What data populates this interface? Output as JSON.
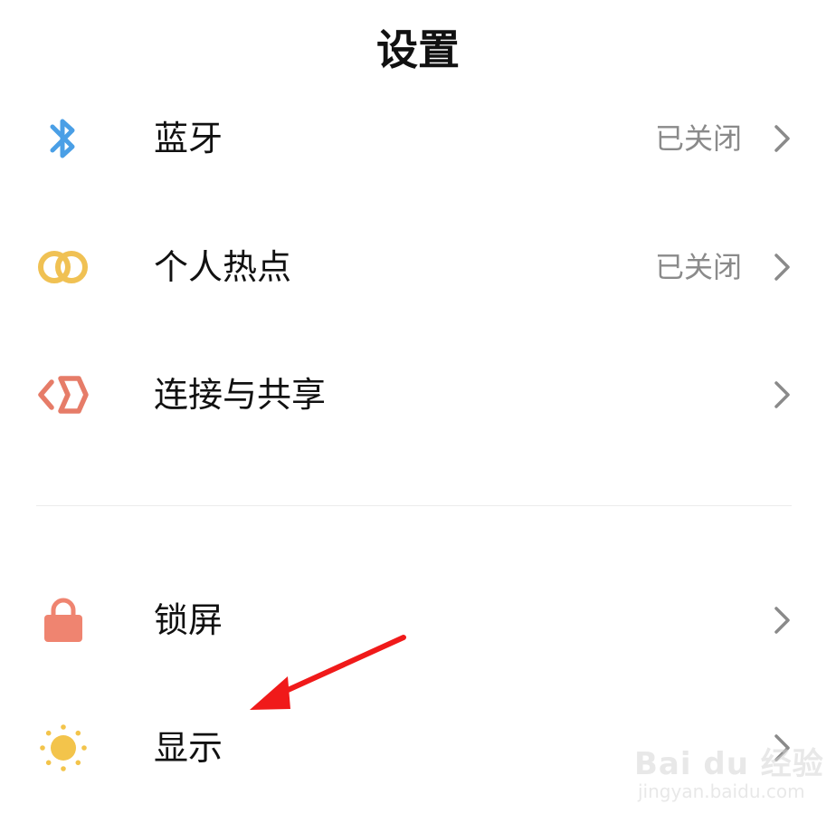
{
  "header": {
    "title": "设置"
  },
  "rows": [
    {
      "label": "蓝牙",
      "status": "已关闭",
      "icon": "bluetooth-icon",
      "color": "#4a9fe6"
    },
    {
      "label": "个人热点",
      "status": "已关闭",
      "icon": "hotspot-icon",
      "color": "#f0c153"
    },
    {
      "label": "连接与共享",
      "status": "",
      "icon": "connection-share-icon",
      "color": "#e67c68"
    },
    {
      "label": "锁屏",
      "status": "",
      "icon": "lock-icon",
      "color": "#ef8470"
    },
    {
      "label": "显示",
      "status": "",
      "icon": "sun-icon",
      "color": "#f3c44b"
    }
  ],
  "annotation": {
    "color": "#f01a1a"
  },
  "watermark": {
    "brand": "Bai du 经验",
    "url": "jingyan.baidu.com"
  }
}
